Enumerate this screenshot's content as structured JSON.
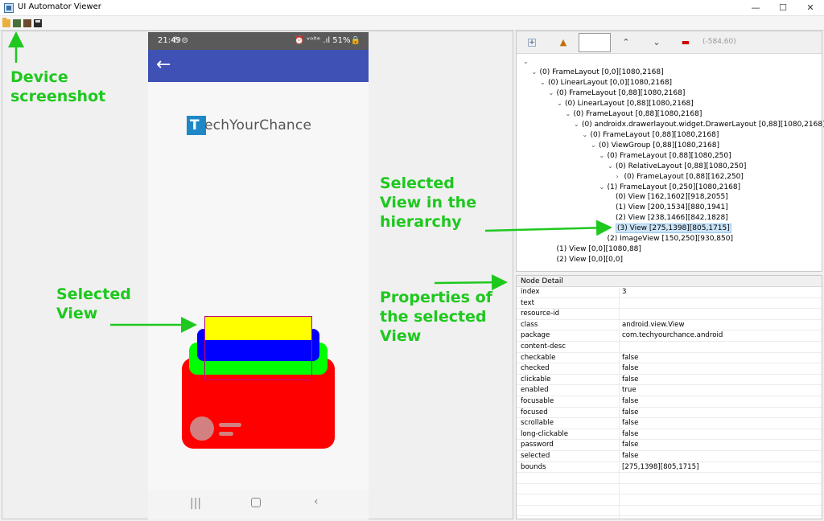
{
  "window": {
    "title": "UI Automator Viewer",
    "min_icon": "—",
    "max_icon": "☐",
    "close_icon": "✕"
  },
  "phone": {
    "status_time": "21:49",
    "status_icons": "✆ ⊝",
    "status_right": "⏰ ᵛᵒˡᵗᵉ .ıl 51%🔒",
    "logo_mark": "T",
    "logo_text": "echYourChance",
    "back_glyph": "←",
    "nav_recents": "|||",
    "nav_back": "‹"
  },
  "annotations": {
    "device": [
      "Device",
      "screenshot"
    ],
    "selected_view": [
      "Selected",
      "View"
    ],
    "selected_hierarchy": [
      "Selected",
      "View in the",
      "hierarchy"
    ],
    "properties": [
      "Properties of",
      "the selected",
      "View"
    ]
  },
  "hierarchy": {
    "coords": "(-584,60)",
    "rows": [
      {
        "indent": 0,
        "chev": "⌄",
        "label": ""
      },
      {
        "indent": 1,
        "chev": "⌄",
        "label": "(0) FrameLayout [0,0][1080,2168]"
      },
      {
        "indent": 2,
        "chev": "⌄",
        "label": "(0) LinearLayout [0,0][1080,2168]"
      },
      {
        "indent": 3,
        "chev": "⌄",
        "label": "(0) FrameLayout [0,88][1080,2168]"
      },
      {
        "indent": 4,
        "chev": "⌄",
        "label": "(0) LinearLayout [0,88][1080,2168]"
      },
      {
        "indent": 5,
        "chev": "⌄",
        "label": "(0) FrameLayout [0,88][1080,2168]"
      },
      {
        "indent": 6,
        "chev": "⌄",
        "label": "(0) androidx.drawerlayout.widget.DrawerLayout [0,88][1080,2168]"
      },
      {
        "indent": 7,
        "chev": "⌄",
        "label": "(0) FrameLayout [0,88][1080,2168]"
      },
      {
        "indent": 8,
        "chev": "⌄",
        "label": "(0) ViewGroup [0,88][1080,2168]"
      },
      {
        "indent": 9,
        "chev": "⌄",
        "label": "(0) FrameLayout [0,88][1080,250]"
      },
      {
        "indent": 10,
        "chev": "⌄",
        "label": "(0) RelativeLayout [0,88][1080,250]"
      },
      {
        "indent": 11,
        "chev": "›",
        "label": "(0) FrameLayout [0,88][162,250]"
      },
      {
        "indent": 9,
        "chev": "⌄",
        "label": "(1) FrameLayout [0,250][1080,2168]"
      },
      {
        "indent": 10,
        "chev": "",
        "label": "(0) View [162,1602][918,2055]"
      },
      {
        "indent": 10,
        "chev": "",
        "label": "(1) View [200,1534][880,1941]"
      },
      {
        "indent": 10,
        "chev": "",
        "label": "(2) View [238,1466][842,1828]"
      },
      {
        "indent": 10,
        "chev": "",
        "label": "(3) View [275,1398][805,1715]",
        "selected": true
      },
      {
        "indent": 9,
        "chev": "",
        "label": "(2) ImageView [150,250][930,850]"
      },
      {
        "indent": 3,
        "chev": "",
        "label": "(1) View [0,0][1080,88]"
      },
      {
        "indent": 3,
        "chev": "",
        "label": "(2) View [0,0][0,0]"
      }
    ]
  },
  "node_detail": {
    "header": "Node Detail",
    "properties": [
      {
        "key": "index",
        "value": "3"
      },
      {
        "key": "text",
        "value": ""
      },
      {
        "key": "resource-id",
        "value": ""
      },
      {
        "key": "class",
        "value": "android.view.View"
      },
      {
        "key": "package",
        "value": "com.techyourchance.android"
      },
      {
        "key": "content-desc",
        "value": ""
      },
      {
        "key": "checkable",
        "value": "false"
      },
      {
        "key": "checked",
        "value": "false"
      },
      {
        "key": "clickable",
        "value": "false"
      },
      {
        "key": "enabled",
        "value": "true"
      },
      {
        "key": "focusable",
        "value": "false"
      },
      {
        "key": "focused",
        "value": "false"
      },
      {
        "key": "scrollable",
        "value": "false"
      },
      {
        "key": "long-clickable",
        "value": "false"
      },
      {
        "key": "password",
        "value": "false"
      },
      {
        "key": "selected",
        "value": "false"
      },
      {
        "key": "bounds",
        "value": "[275,1398][805,1715]"
      },
      {
        "key": "",
        "value": ""
      },
      {
        "key": "",
        "value": ""
      },
      {
        "key": "",
        "value": ""
      },
      {
        "key": "",
        "value": ""
      }
    ]
  },
  "colors": {
    "annotation": "#1ec81e",
    "appbar": "#3f51b5",
    "card_yellow": "#ffff00",
    "card_blue": "#0000ff",
    "card_green": "#00ff00",
    "card_red": "#ff0000"
  },
  "icons": {
    "toolbar": [
      "folder-open-icon",
      "device-screenshot-icon",
      "device-screenshot-compressed-icon",
      "save-icon"
    ],
    "hierarchy_toolbar": [
      "expand-all-icon",
      "warning-icon",
      "up-icon",
      "down-icon",
      "remove-icon"
    ]
  }
}
